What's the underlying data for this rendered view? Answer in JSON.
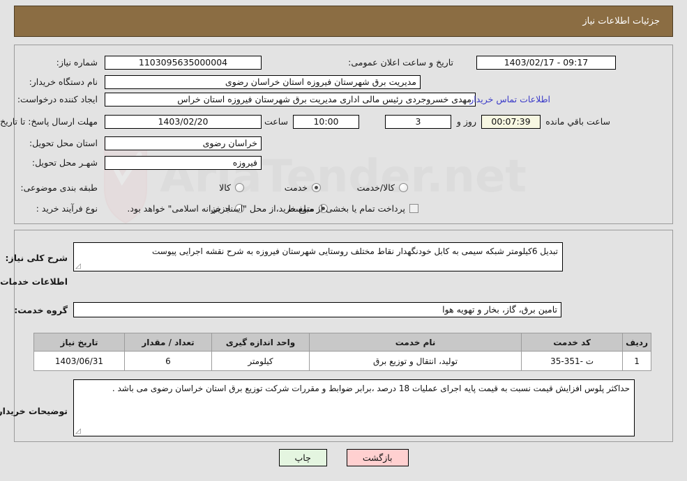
{
  "header": {
    "title": "جزئیات اطلاعات نیاز"
  },
  "colors": {
    "header_bg": "#8b6d43",
    "panel_bg": "#e3e3e3",
    "table_header_bg": "#c8c8c8",
    "link": "#3a3ac8",
    "countdown_bg": "#f7f7e2",
    "back_button_bg": "#ffd0d0",
    "print_button_bg": "#e4f5e0"
  },
  "form": {
    "need_number_label": "شماره نیاز:",
    "need_number_value": "1103095635000004",
    "announce_datetime_label": "تاریخ و ساعت اعلان عمومی:",
    "announce_datetime_value": "09:17 - 1403/02/17",
    "buyer_org_label": "نام دستگاه خریدار:",
    "buyer_org_value": "مدیریت برق شهرستان فیروزه استان خراسان رضوی",
    "requester_label": "ایجاد کننده درخواست:",
    "requester_value": "مهدی خسروجردی رئیس مالی اداری مدیریت برق شهرستان فیروزه استان خراس",
    "buyer_contact_link": "اطلاعات تماس خریدار",
    "deadline_label": "مهلت ارسال پاسخ: تا تاریخ:",
    "deadline_date": "1403/02/20",
    "deadline_time_label": "ساعت",
    "deadline_time": "10:00",
    "remaining_days": "3",
    "remaining_days_label": "روز و",
    "remaining_time": "00:07:39",
    "remaining_time_label": "ساعت باقي مانده",
    "province_label": "استان محل تحویل:",
    "province_value": "خراسان رضوی",
    "city_label": "شهـر محل تحویل:",
    "city_value": "فیروزه",
    "category_label": "طبقه بندی موضوعی:",
    "category_options": [
      {
        "label": "کالا",
        "selected": false
      },
      {
        "label": "خدمت",
        "selected": true
      },
      {
        "label": "کالا/خدمت",
        "selected": false
      }
    ],
    "process_label": "نوع فرآیند خرید :",
    "process_options": [
      {
        "label": "جزیي",
        "selected": false
      },
      {
        "label": "متوسط",
        "selected": true
      }
    ],
    "treasury_checkbox_label": "پرداخت تمام یا بخشی از مبلغ خرید،از محل \"اسناد خزانه اسلامی\" خواهد بود.",
    "treasury_checkbox_checked": false
  },
  "description": {
    "label": "شرح کلی نیاز:",
    "value": "تبدیل 6کیلومتر شبکه سیمی به کابل خودنگهدار نقاط مختلف روستایی شهرستان فیروزه به شرح نقشه اجرایی پیوست"
  },
  "services": {
    "section_title": "اطلاعات خدمات مورد نیاز",
    "group_label": "گروه خدمت:",
    "group_value": "تامین برق، گاز، بخار و تهویه هوا",
    "columns": [
      "ردیف",
      "کد خدمت",
      "نام خدمت",
      "واحد اندازه گیری",
      "تعداد / مقدار",
      "تاریخ نیاز"
    ],
    "rows": [
      {
        "index": "1",
        "code": "ت -351-35",
        "name": "تولید، انتقال و توزیع برق",
        "unit": "کیلومتر",
        "quantity": "6",
        "need_date": "1403/06/31"
      }
    ]
  },
  "buyer_notes": {
    "label": "توضیحات خریدار:",
    "value": "حداکثر پلوس افزایش قیمت نسبت به قیمت پایه اجرای عملیات 18 درصد ،برابر ضوابط و مقررات شرکت توزیع برق استان خراسان رضوی می باشد ."
  },
  "buttons": {
    "print": "چاپ",
    "back": "بازگشت"
  },
  "watermark": {
    "text": "AriaTender.net"
  }
}
